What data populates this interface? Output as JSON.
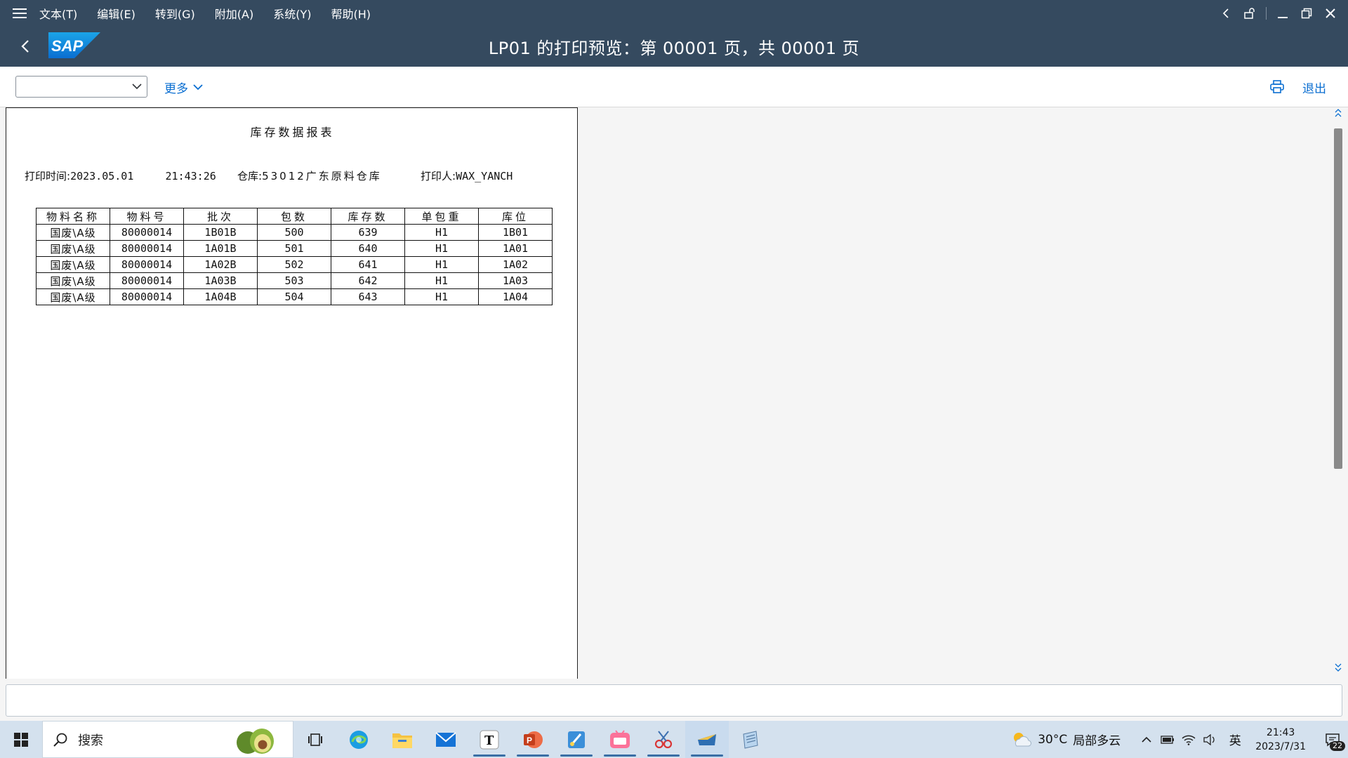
{
  "menu": {
    "items": [
      "文本(T)",
      "编辑(E)",
      "转到(G)",
      "附加(A)",
      "系统(Y)",
      "帮助(H)"
    ]
  },
  "header": {
    "logo": "SAP",
    "title": "LP01 的打印预览：第 00001 页，共 00001   页"
  },
  "toolbar": {
    "combo_value": "",
    "more_label": "更多",
    "exit_label": "退出"
  },
  "report": {
    "title": "库存数据报表",
    "print_time_label": "打印时间:",
    "print_time_value": "2023.05.01     21:43:26",
    "warehouse_label": "仓库:",
    "warehouse_value": "53012广东原料仓库",
    "printer_label": "打印人:",
    "printer_value": "WAX_YANCH",
    "columns": [
      "物料名称",
      "物料号",
      "批次",
      "包数",
      "库存数",
      "单包重",
      "库位"
    ],
    "rows": [
      [
        "国废\\A级",
        "80000014",
        "1B01B",
        "500",
        "639",
        "H1",
        "1B01"
      ],
      [
        "国废\\A级",
        "80000014",
        "1A01B",
        "501",
        "640",
        "H1",
        "1A01"
      ],
      [
        "国废\\A级",
        "80000014",
        "1A02B",
        "502",
        "641",
        "H1",
        "1A02"
      ],
      [
        "国废\\A级",
        "80000014",
        "1A03B",
        "503",
        "642",
        "H1",
        "1A03"
      ],
      [
        "国废\\A级",
        "80000014",
        "1A04B",
        "504",
        "643",
        "H1",
        "1A04"
      ]
    ]
  },
  "status": {
    "message": ""
  },
  "taskbar": {
    "search_label": "搜索",
    "apps": [
      "task-view",
      "edge",
      "file-explorer",
      "mail",
      "typora",
      "powerpoint",
      "paint",
      "bilibili",
      "snipping-tool",
      "sap-logon",
      "notepad"
    ],
    "weather_temp": "30°C",
    "weather_desc": "局部多云",
    "ime": "英",
    "time": "21:43",
    "date": "2023/7/31",
    "notification_count": "22"
  },
  "colors": {
    "shell": "#354a5f",
    "link": "#0a6ed1",
    "taskbar": "#d4e1ee"
  }
}
